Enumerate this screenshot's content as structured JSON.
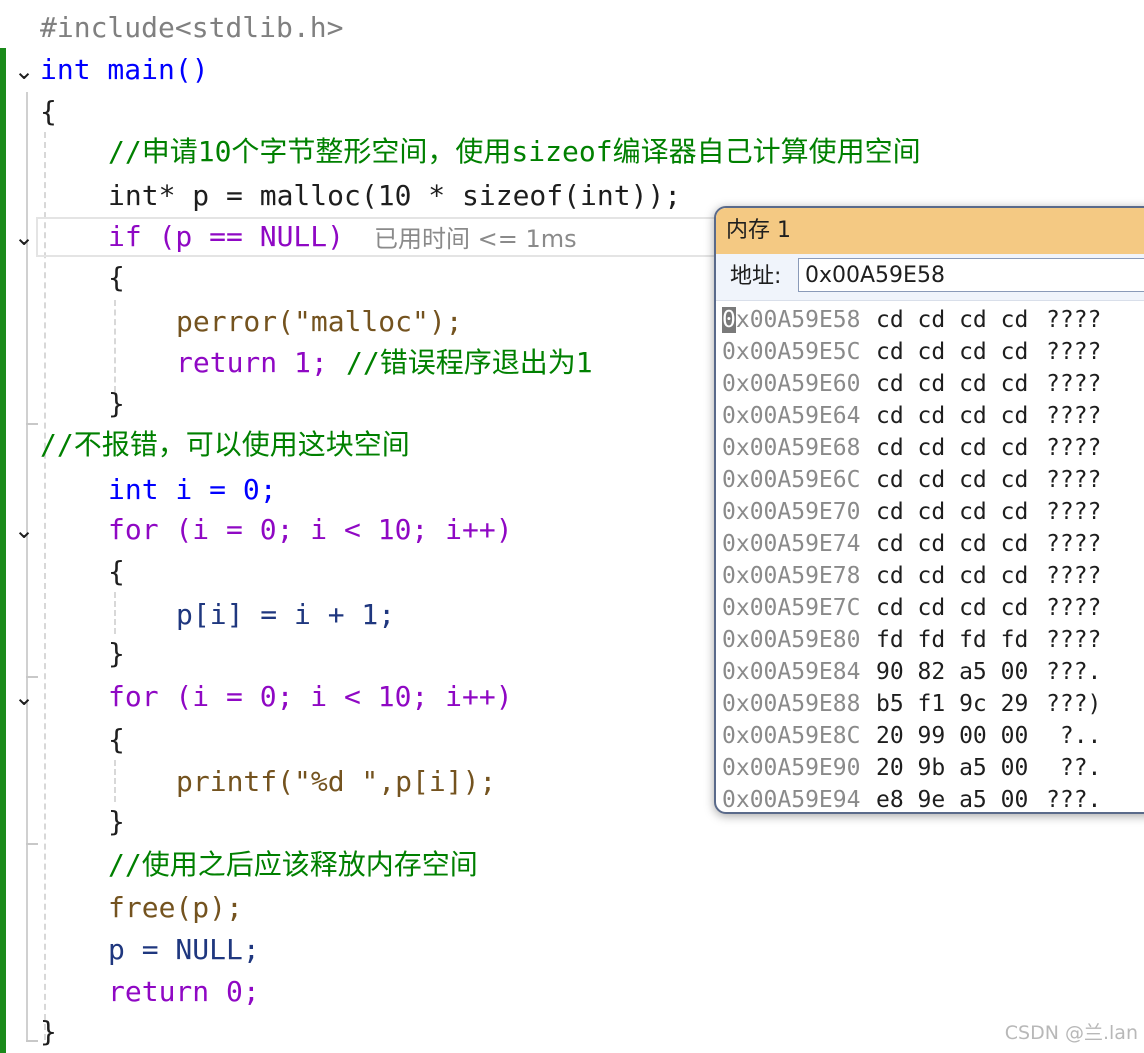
{
  "code": {
    "include": "#include<stdlib.h>",
    "main_sig": "int main()",
    "open_brace": "{",
    "comment1": "//申请10个字节整形空间，使用sizeof编译器自己计算使用空间",
    "alloc_line": "int* p = malloc(10 * sizeof(int));",
    "if_line": "if (p == NULL)",
    "elapsed": "已用时间 <= 1ms",
    "if_open": "{",
    "perror_line": "perror(\"malloc\");",
    "return1_line": "return 1;",
    "return1_comment": "//错误程序退出为1",
    "if_close": "}",
    "comment2": "//不报错，可以使用这块空间",
    "int_i": "int i = 0;",
    "for1": "for (i = 0; i < 10; i++)",
    "for1_open": "{",
    "assign_line": "p[i] = i + 1;",
    "for1_close": "}",
    "for2": "for (i = 0; i < 10; i++)",
    "for2_open": "{",
    "printf_line": "printf(\"%d \",p[i]);",
    "for2_close": "}",
    "comment3": "//使用之后应该释放内存空间",
    "free_line": "free(p);",
    "null_line": "p = NULL;",
    "return0_line": "return 0;",
    "close_brace": "}"
  },
  "memory_window": {
    "title": "内存 1",
    "address_label": "地址:",
    "address_value": "0x00A59E58",
    "rows": [
      {
        "addr": "0x00A59E58",
        "bytes": "cd cd cd cd",
        "chars": "????"
      },
      {
        "addr": "0x00A59E5C",
        "bytes": "cd cd cd cd",
        "chars": "????"
      },
      {
        "addr": "0x00A59E60",
        "bytes": "cd cd cd cd",
        "chars": "????"
      },
      {
        "addr": "0x00A59E64",
        "bytes": "cd cd cd cd",
        "chars": "????"
      },
      {
        "addr": "0x00A59E68",
        "bytes": "cd cd cd cd",
        "chars": "????"
      },
      {
        "addr": "0x00A59E6C",
        "bytes": "cd cd cd cd",
        "chars": "????"
      },
      {
        "addr": "0x00A59E70",
        "bytes": "cd cd cd cd",
        "chars": "????"
      },
      {
        "addr": "0x00A59E74",
        "bytes": "cd cd cd cd",
        "chars": "????"
      },
      {
        "addr": "0x00A59E78",
        "bytes": "cd cd cd cd",
        "chars": "????"
      },
      {
        "addr": "0x00A59E7C",
        "bytes": "cd cd cd cd",
        "chars": "????"
      },
      {
        "addr": "0x00A59E80",
        "bytes": "fd fd fd fd",
        "chars": "????"
      },
      {
        "addr": "0x00A59E84",
        "bytes": "90 82 a5 00",
        "chars": "???."
      },
      {
        "addr": "0x00A59E88",
        "bytes": "b5 f1 9c 29",
        "chars": "???)"
      },
      {
        "addr": "0x00A59E8C",
        "bytes": "20 99 00 00",
        "chars": " ?.."
      },
      {
        "addr": "0x00A59E90",
        "bytes": "20 9b a5 00",
        "chars": " ??."
      },
      {
        "addr": "0x00A59E94",
        "bytes": "e8 9e a5 00",
        "chars": "???."
      }
    ]
  },
  "watermark": "CSDN @兰.lan"
}
